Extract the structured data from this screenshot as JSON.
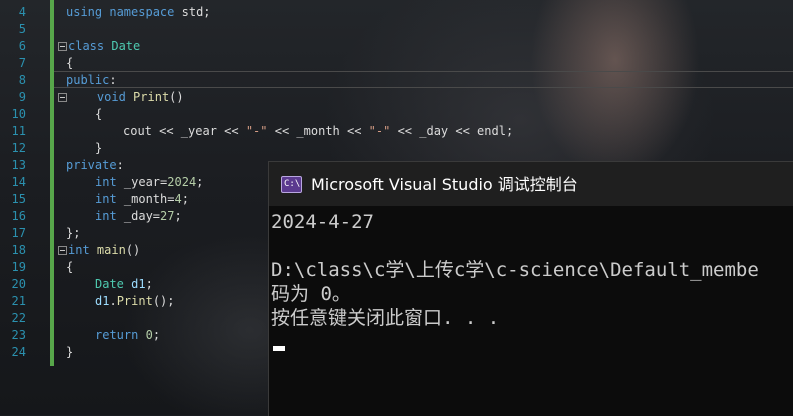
{
  "editor": {
    "line_numbers": [
      "4",
      "5",
      "6",
      "7",
      "8",
      "9",
      "10",
      "11",
      "12",
      "13",
      "14",
      "15",
      "16",
      "17",
      "18",
      "19",
      "20",
      "21",
      "22",
      "23",
      "24"
    ],
    "lines": {
      "l4": {
        "kw1": "using",
        "kw2": "namespace",
        "rest": " std;"
      },
      "l6": {
        "kw": "class",
        "ty": "Date"
      },
      "l7": {
        "text": "{"
      },
      "l8": {
        "kw": "public",
        "rest": ":"
      },
      "l9": {
        "kw": "void",
        "fn": "Print",
        "rest": "()"
      },
      "l10": {
        "text": "{"
      },
      "l11": {
        "a": "cout << _year << ",
        "s1": "\"-\"",
        "b": " << _month << ",
        "s2": "\"-\"",
        "c": " << _day << endl;"
      },
      "l12": {
        "text": "}"
      },
      "l13": {
        "kw": "private",
        "rest": ":"
      },
      "l14": {
        "kw": "int",
        "rest": " _year=",
        "num": "2024",
        "end": ";"
      },
      "l15": {
        "kw": "int",
        "rest": " _month=",
        "num": "4",
        "end": ";"
      },
      "l16": {
        "kw": "int",
        "rest": " _day=",
        "num": "27",
        "end": ";"
      },
      "l17": {
        "text": "};"
      },
      "l18": {
        "kw": "int",
        "fn": "main",
        "rest": "()"
      },
      "l19": {
        "text": "{"
      },
      "l20": {
        "ty": "Date",
        "var": "d1",
        "end": ";"
      },
      "l21": {
        "var": "d1",
        "dot": ".",
        "fn": "Print",
        "end": "();"
      },
      "l23": {
        "kw": "return",
        "num": "0",
        "end": ";"
      },
      "l24": {
        "text": "}"
      }
    }
  },
  "console": {
    "icon_text": "C:\\",
    "title": "Microsoft Visual Studio 调试控制台",
    "output": [
      "2024-4-27",
      "",
      "D:\\class\\c学\\上传c学\\c-science\\Default_membe",
      "码为 0。",
      "按任意键关闭此窗口. . ."
    ]
  },
  "colors": {
    "keyword": "#569cd6",
    "type": "#4ec9b0",
    "function": "#dcdcaa",
    "string": "#d69d85",
    "line_number": "#2b91af",
    "change_bar": "#57a64a",
    "console_bg": "#0c0c0c"
  },
  "icons": [
    "fold-collapse-icon",
    "console-app-icon"
  ]
}
